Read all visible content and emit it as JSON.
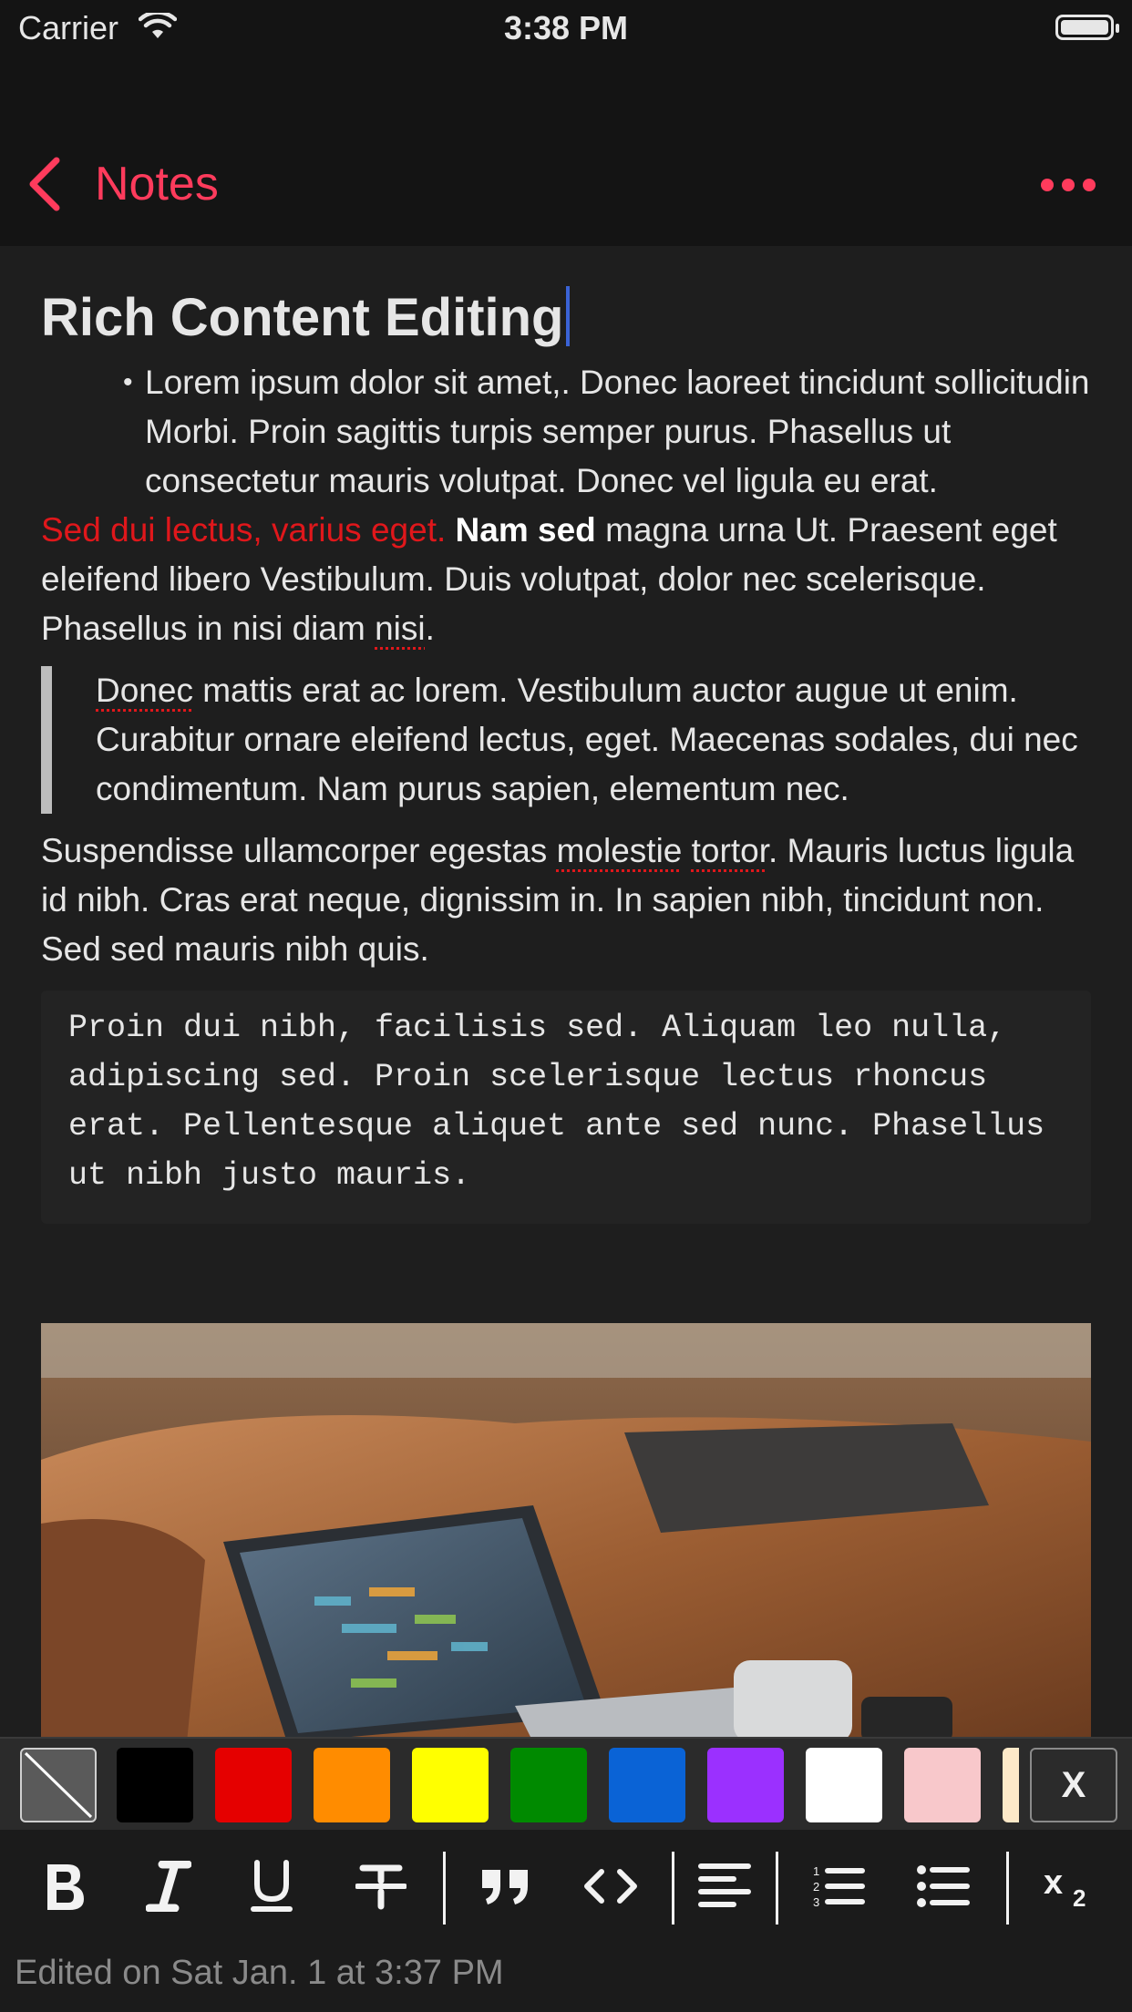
{
  "status_bar": {
    "carrier": "Carrier",
    "time": "3:38 PM"
  },
  "nav": {
    "back_label": "Notes"
  },
  "note": {
    "title": "Rich Content Editing",
    "bullet": "Lorem ipsum dolor sit amet,. Donec laoreet tincidunt sollicitudin Morbi. Proin sagittis turpis semper purus. Phasellus ut consectetur mauris volutpat. Donec vel ligula eu erat.",
    "para1_red": "Sed dui lectus, varius eget.",
    "para1_bold": "Nam sed",
    "para1_rest": "magna urna Ut. Praesent eget eleifend libero Vestibulum. Duis volutpat, dolor nec scelerisque. Phasellus in nisi diam",
    "para1_misspelled": "nisi",
    "para1_end": ".",
    "quote_misspelled": "Donec",
    "quote_rest": "mattis erat ac lorem. Vestibulum auctor augue ut enim. Curabitur ornare eleifend lectus, eget. Maecenas sodales, dui nec condimentum. Nam purus sapien, elementum nec.",
    "para2_start": "Suspendisse ullamcorper egestas",
    "para2_miss1": "molestie",
    "para2_miss2": "tortor",
    "para2_rest": ". Mauris luctus ligula id nibh. Cras erat neque, dignissim in. In sapien nibh, tincidunt non. Sed sed mauris nibh quis.",
    "code": "Proin dui nibh, facilisis sed. Aliquam leo nulla, adipiscing sed. Proin scelerisque lectus rhoncus erat. Pellentesque aliquet ante sed nunc. Phasellus ut nibh justo mauris."
  },
  "palette": {
    "colors": [
      "#000000",
      "#e50000",
      "#ff8c00",
      "#ffff00",
      "#008a00",
      "#0a63d6",
      "#9b30ff",
      "#ffffff",
      "#f8c8cb",
      "#fde9c8"
    ],
    "close_label": "X"
  },
  "toolbar": {
    "tools": [
      "bold-icon",
      "italic-icon",
      "underline-icon",
      "strikethrough-icon",
      "quote-icon",
      "code-icon",
      "align-left-icon",
      "numbered-list-icon",
      "bullet-list-icon",
      "subscript-icon"
    ]
  },
  "footer": {
    "edited": "Edited on Sat Jan. 1 at 3:37 PM"
  },
  "accent_color": "#ff3b5c"
}
